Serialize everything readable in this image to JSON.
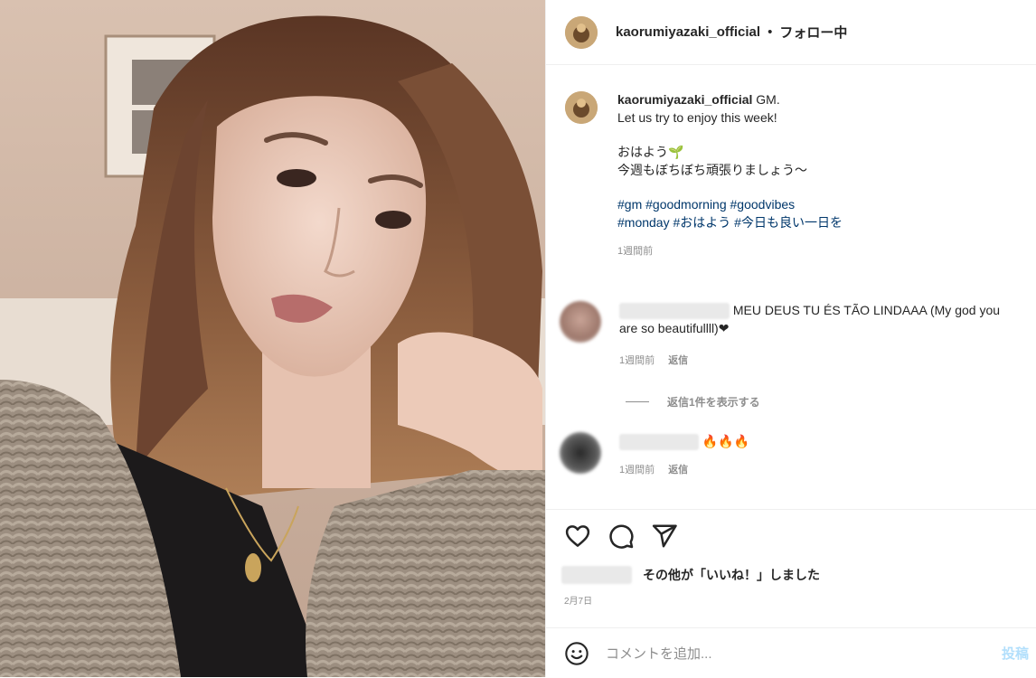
{
  "header": {
    "username": "kaorumiyazaki_official",
    "separator": "•",
    "follow_state": "フォロー中"
  },
  "caption": {
    "username": "kaorumiyazaki_official",
    "line1": "GM.",
    "line2": "Let us try to enjoy this week!",
    "line3": "おはよう🌱",
    "line4": "今週もぼちぼち頑張りましょう～",
    "hashtags_line1": "#gm #goodmorning #goodvibes",
    "hashtags_line2": "#monday #おはよう #今日も良い一日を",
    "time": "1週間前"
  },
  "comments": [
    {
      "text": "MEU DEUS TU ÉS TÃO LINDAAA (My god you are so beautifulll)❤",
      "text_line1": "MEU DEUS TU ÉS TÃO LINDAAA (My god you",
      "text_line2": "are so beautifullll)❤",
      "time": "1週間前",
      "reply": "返信"
    },
    {
      "text": "🔥🔥🔥",
      "time": "1週間前",
      "reply": "返信"
    }
  ],
  "view_replies": "返信1件を表示する",
  "actions": {
    "icons": [
      "heart-icon",
      "comment-icon",
      "share-icon"
    ]
  },
  "likes": {
    "text": "その他が「いいね！」しました",
    "bold": "その他"
  },
  "date": "2月7日",
  "add_comment": {
    "placeholder": "コメントを追加...",
    "post_label": "投稿"
  },
  "colors": {
    "hashtag": "#00376b",
    "muted": "#8e8e8e",
    "post_button": "#b2dffc"
  }
}
